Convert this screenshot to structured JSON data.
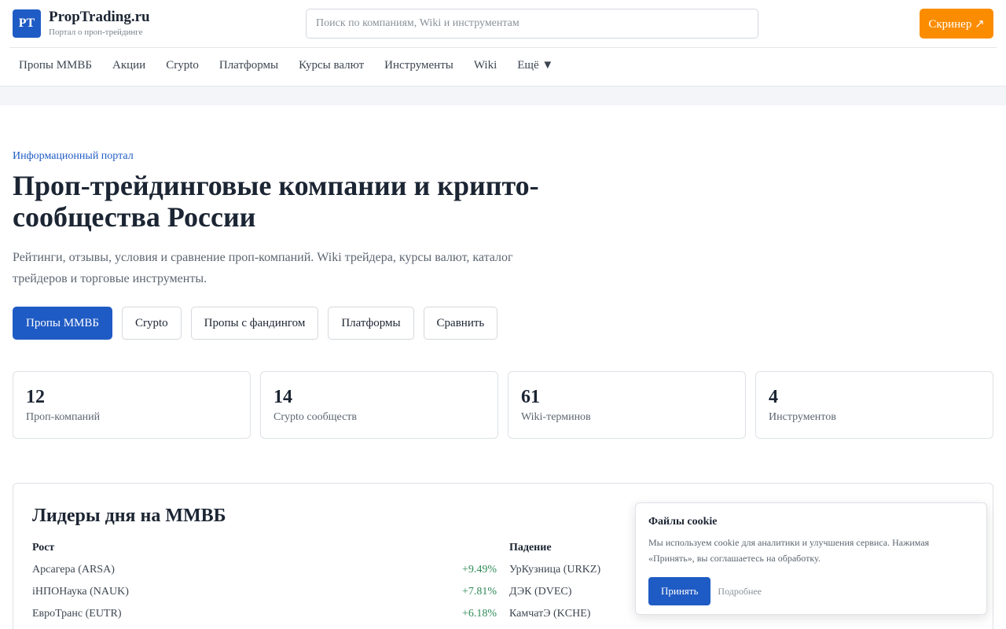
{
  "header": {
    "logo_text": "PT",
    "brand_name": "PropTrading.ru",
    "brand_tagline": "Портал о проп-трейдинге",
    "search_placeholder": "Поиск по компаниям, Wiki и инструментам",
    "screener_label": "Скринер ↗"
  },
  "nav": [
    "Пропы ММВБ",
    "Акции",
    "Crypto",
    "Платформы",
    "Курсы валют",
    "Инструменты",
    "Wiki",
    "Ещё ▼"
  ],
  "hero": {
    "eyebrow": "Информационный портал",
    "title": "Проп-трейдинговые компании и крипто-сообщества России",
    "description": "Рейтинги, отзывы, условия и сравнение проп-компаний. Wiki трейдера, курсы валют, каталог трейдеров и торговые инструменты.",
    "ctas": [
      "Пропы ММВБ",
      "Crypto",
      "Пропы с фандингом",
      "Платформы",
      "Сравнить"
    ]
  },
  "stats": [
    {
      "value": "12",
      "label": "Проп-компаний"
    },
    {
      "value": "14",
      "label": "Crypto сообществ"
    },
    {
      "value": "61",
      "label": "Wiki-терминов"
    },
    {
      "value": "4",
      "label": "Инструментов"
    }
  ],
  "leaders": {
    "title": "Лидеры дня на ММВБ",
    "growth_header": "Рост",
    "fall_header": "Падение",
    "growth": [
      {
        "name": "Арсагера (ARSA)",
        "pct": "+9.49%"
      },
      {
        "name": "iНПОНаука (NAUK)",
        "pct": "+7.81%"
      },
      {
        "name": "ЕвроТранс (EUTR)",
        "pct": "+6.18%"
      }
    ],
    "fall": [
      {
        "name": "УрКузница (URKZ)"
      },
      {
        "name": "ДЭК (DVEC)"
      },
      {
        "name": "КамчатЭ (KCHE)"
      }
    ]
  },
  "cookie": {
    "title": "Файлы cookie",
    "text": "Мы используем cookie для аналитики и улучшения сервиса. Нажимая «Принять», вы соглашаетесь на обработку.",
    "accept_label": "Принять",
    "more_label": "Подробнее"
  },
  "colors": {
    "primary": "#1f5bc4",
    "accent": "#fb8c00",
    "positive": "#2e8b57"
  }
}
